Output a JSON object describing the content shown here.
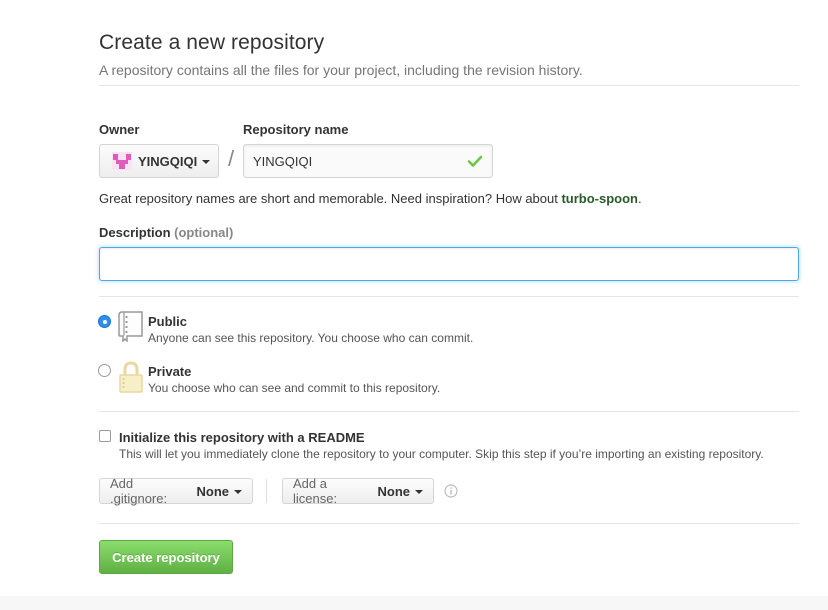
{
  "header": {
    "title": "Create a new repository",
    "subtitle": "A repository contains all the files for your project, including the revision history."
  },
  "owner": {
    "label": "Owner",
    "name": "YINGQIQI"
  },
  "repo": {
    "label": "Repository name",
    "value": "YINGQIQI",
    "slash": "/",
    "hint_prefix": "Great repository names are short and memorable. Need inspiration? How about ",
    "hint_suggestion": "turbo-spoon",
    "hint_suffix": "."
  },
  "description": {
    "label": "Description",
    "optional": "(optional)",
    "value": ""
  },
  "visibility": {
    "public_title": "Public",
    "public_desc": "Anyone can see this repository. You choose who can commit.",
    "private_title": "Private",
    "private_desc": "You choose who can see and commit to this repository.",
    "selected": "public"
  },
  "init": {
    "title": "Initialize this repository with a README",
    "desc": "This will let you immediately clone the repository to your computer. Skip this step if you’re importing an existing repository.",
    "checked": false
  },
  "gitignore": {
    "prefix": "Add .gitignore:",
    "value": "None"
  },
  "license": {
    "prefix": "Add a license:",
    "value": "None"
  },
  "submit_label": "Create repository",
  "colors": {
    "accent_green": "#60b044",
    "focus_blue": "#51a7e8",
    "radio_blue": "#2e8ef0",
    "check_green": "#6cc644",
    "avatar_pink": "#e05bbd"
  },
  "icons": [
    "check-icon",
    "repo-icon",
    "lock-icon",
    "info-icon",
    "caret-down-icon"
  ]
}
